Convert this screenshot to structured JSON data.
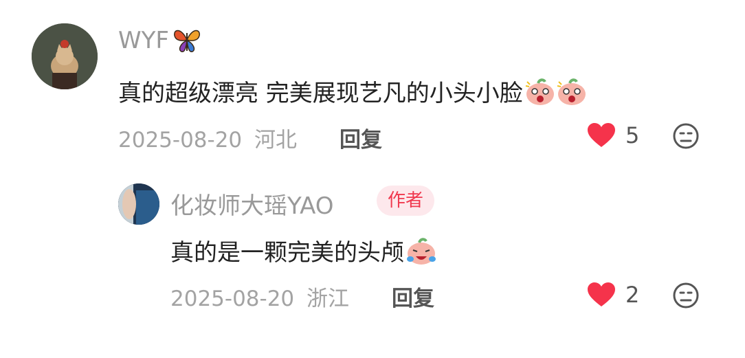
{
  "comments": [
    {
      "username": "WYF",
      "username_emoji": "butterfly-icon",
      "content": "真的超级漂亮 完美展现艺凡的小头小脸",
      "content_emojis": [
        "shocked-peach-emoji",
        "shocked-peach-emoji"
      ],
      "date": "2025-08-20",
      "location": "河北",
      "reply_label": "回复",
      "likes": "5",
      "liked": true,
      "avatar": "cat-avatar"
    },
    {
      "username": "化妆师大瑶YAO",
      "badge": "作者",
      "content": "真的是一颗完美的头颅",
      "content_emojis": [
        "laughing-crying-peach-emoji"
      ],
      "date": "2025-08-20",
      "location": "浙江",
      "reply_label": "回复",
      "likes": "2",
      "liked": true,
      "avatar": "person-avatar"
    }
  ],
  "colors": {
    "like_red": "#f5334b",
    "badge_bg": "#fde8ec",
    "badge_text": "#f0384e"
  }
}
